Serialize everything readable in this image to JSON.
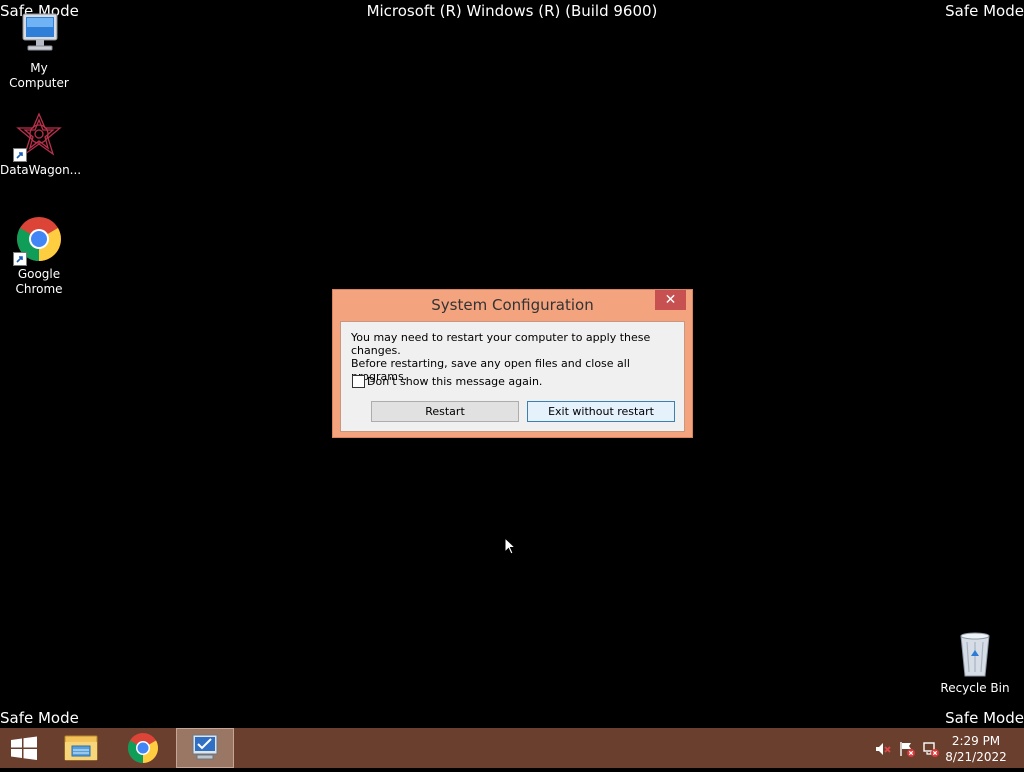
{
  "desktop": {
    "corner_label": "Safe Mode",
    "build_text": "Microsoft (R) Windows (R) (Build 9600)",
    "icons": [
      {
        "label": "My Computer",
        "icon": "computer-icon"
      },
      {
        "label": "DataWagon...",
        "icon": "datawagon-icon"
      },
      {
        "label": "Google Chrome",
        "icon": "chrome-icon"
      },
      {
        "label": "Recycle Bin",
        "icon": "recycle-bin-icon"
      }
    ]
  },
  "dialog": {
    "title": "System Configuration",
    "close_glyph": "✕",
    "message_line1": "You may need to restart your computer to apply these changes.",
    "message_line2": "Before restarting, save any open files and close all programs.",
    "checkbox_label": "Don't show this message again.",
    "checkbox_checked": false,
    "restart_label": "Restart",
    "exit_label": "Exit without restart"
  },
  "taskbar": {
    "items": [
      "start-icon",
      "file-explorer-icon",
      "chrome-icon",
      "msconfig-icon"
    ],
    "active_item": "msconfig-icon",
    "tray": [
      "volume-muted-icon",
      "action-center-flag-icon",
      "network-disconnected-icon"
    ],
    "time": "2:29 PM",
    "date": "8/21/2022"
  },
  "colors": {
    "dialog_frame": "#f4a37f",
    "taskbar": "#6b3f2e",
    "close_button": "#c75050"
  }
}
